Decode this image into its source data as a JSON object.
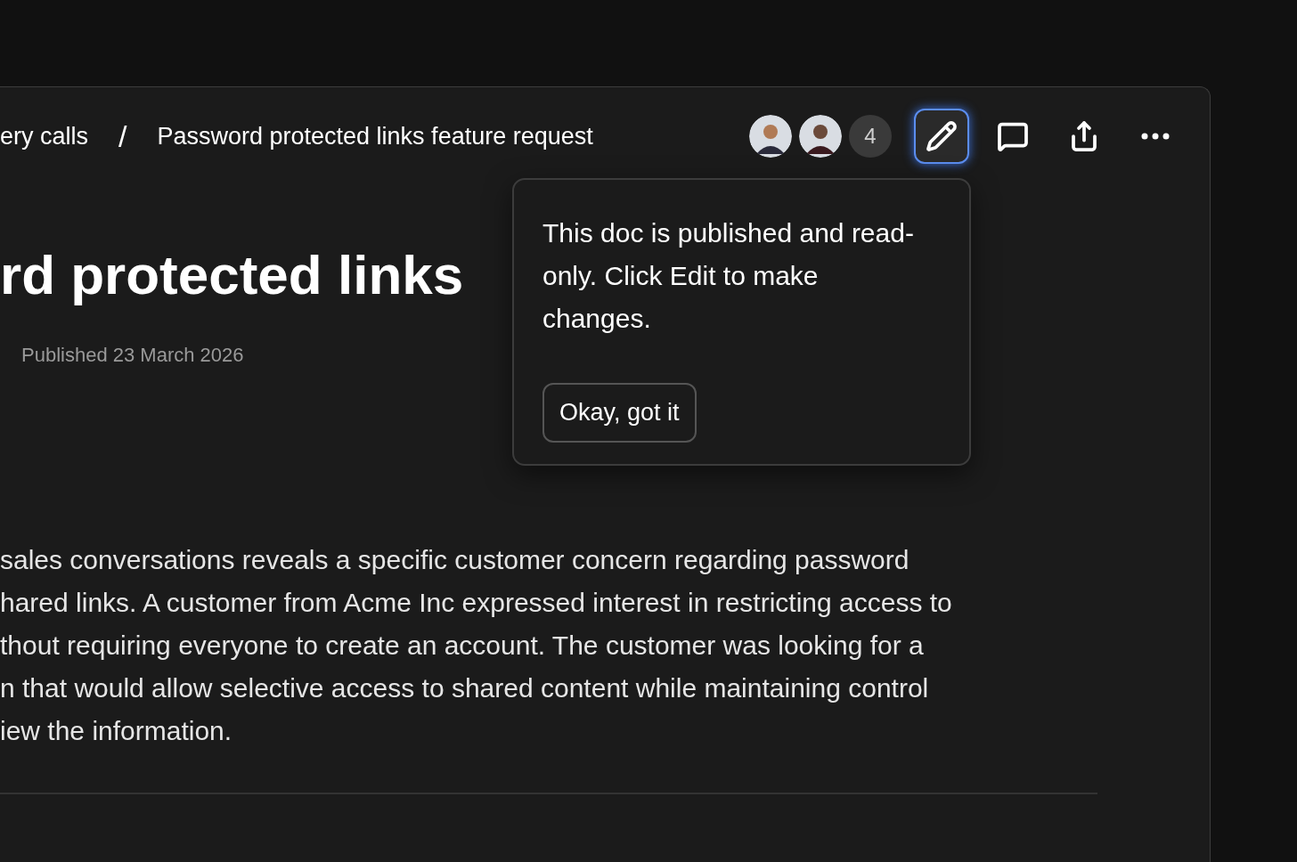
{
  "breadcrumb": {
    "items": [
      "ery calls",
      "Password protected links feature request"
    ],
    "separator": "/"
  },
  "collaborators": {
    "avatars": [
      {
        "kind": "avatar"
      },
      {
        "kind": "avatar"
      }
    ],
    "count": "4"
  },
  "toolbar": [
    {
      "kind": "edit",
      "active": true
    },
    {
      "kind": "comment",
      "active": false
    },
    {
      "kind": "share",
      "active": false
    },
    {
      "kind": "more",
      "active": false
    }
  ],
  "popover": {
    "message": "This doc is published and read-only. Click Edit to make changes.",
    "button": "Okay, got it"
  },
  "document": {
    "title": "rd protected links",
    "published": "Published 23 March 2026",
    "body_lines": [
      "sales conversations reveals a specific customer concern regarding password",
      "hared links. A customer from Acme Inc expressed interest in restricting access to",
      "thout requiring everyone to create an account. The customer was looking for a",
      "n that would allow selective access to shared content while maintaining control",
      "iew the information."
    ]
  }
}
